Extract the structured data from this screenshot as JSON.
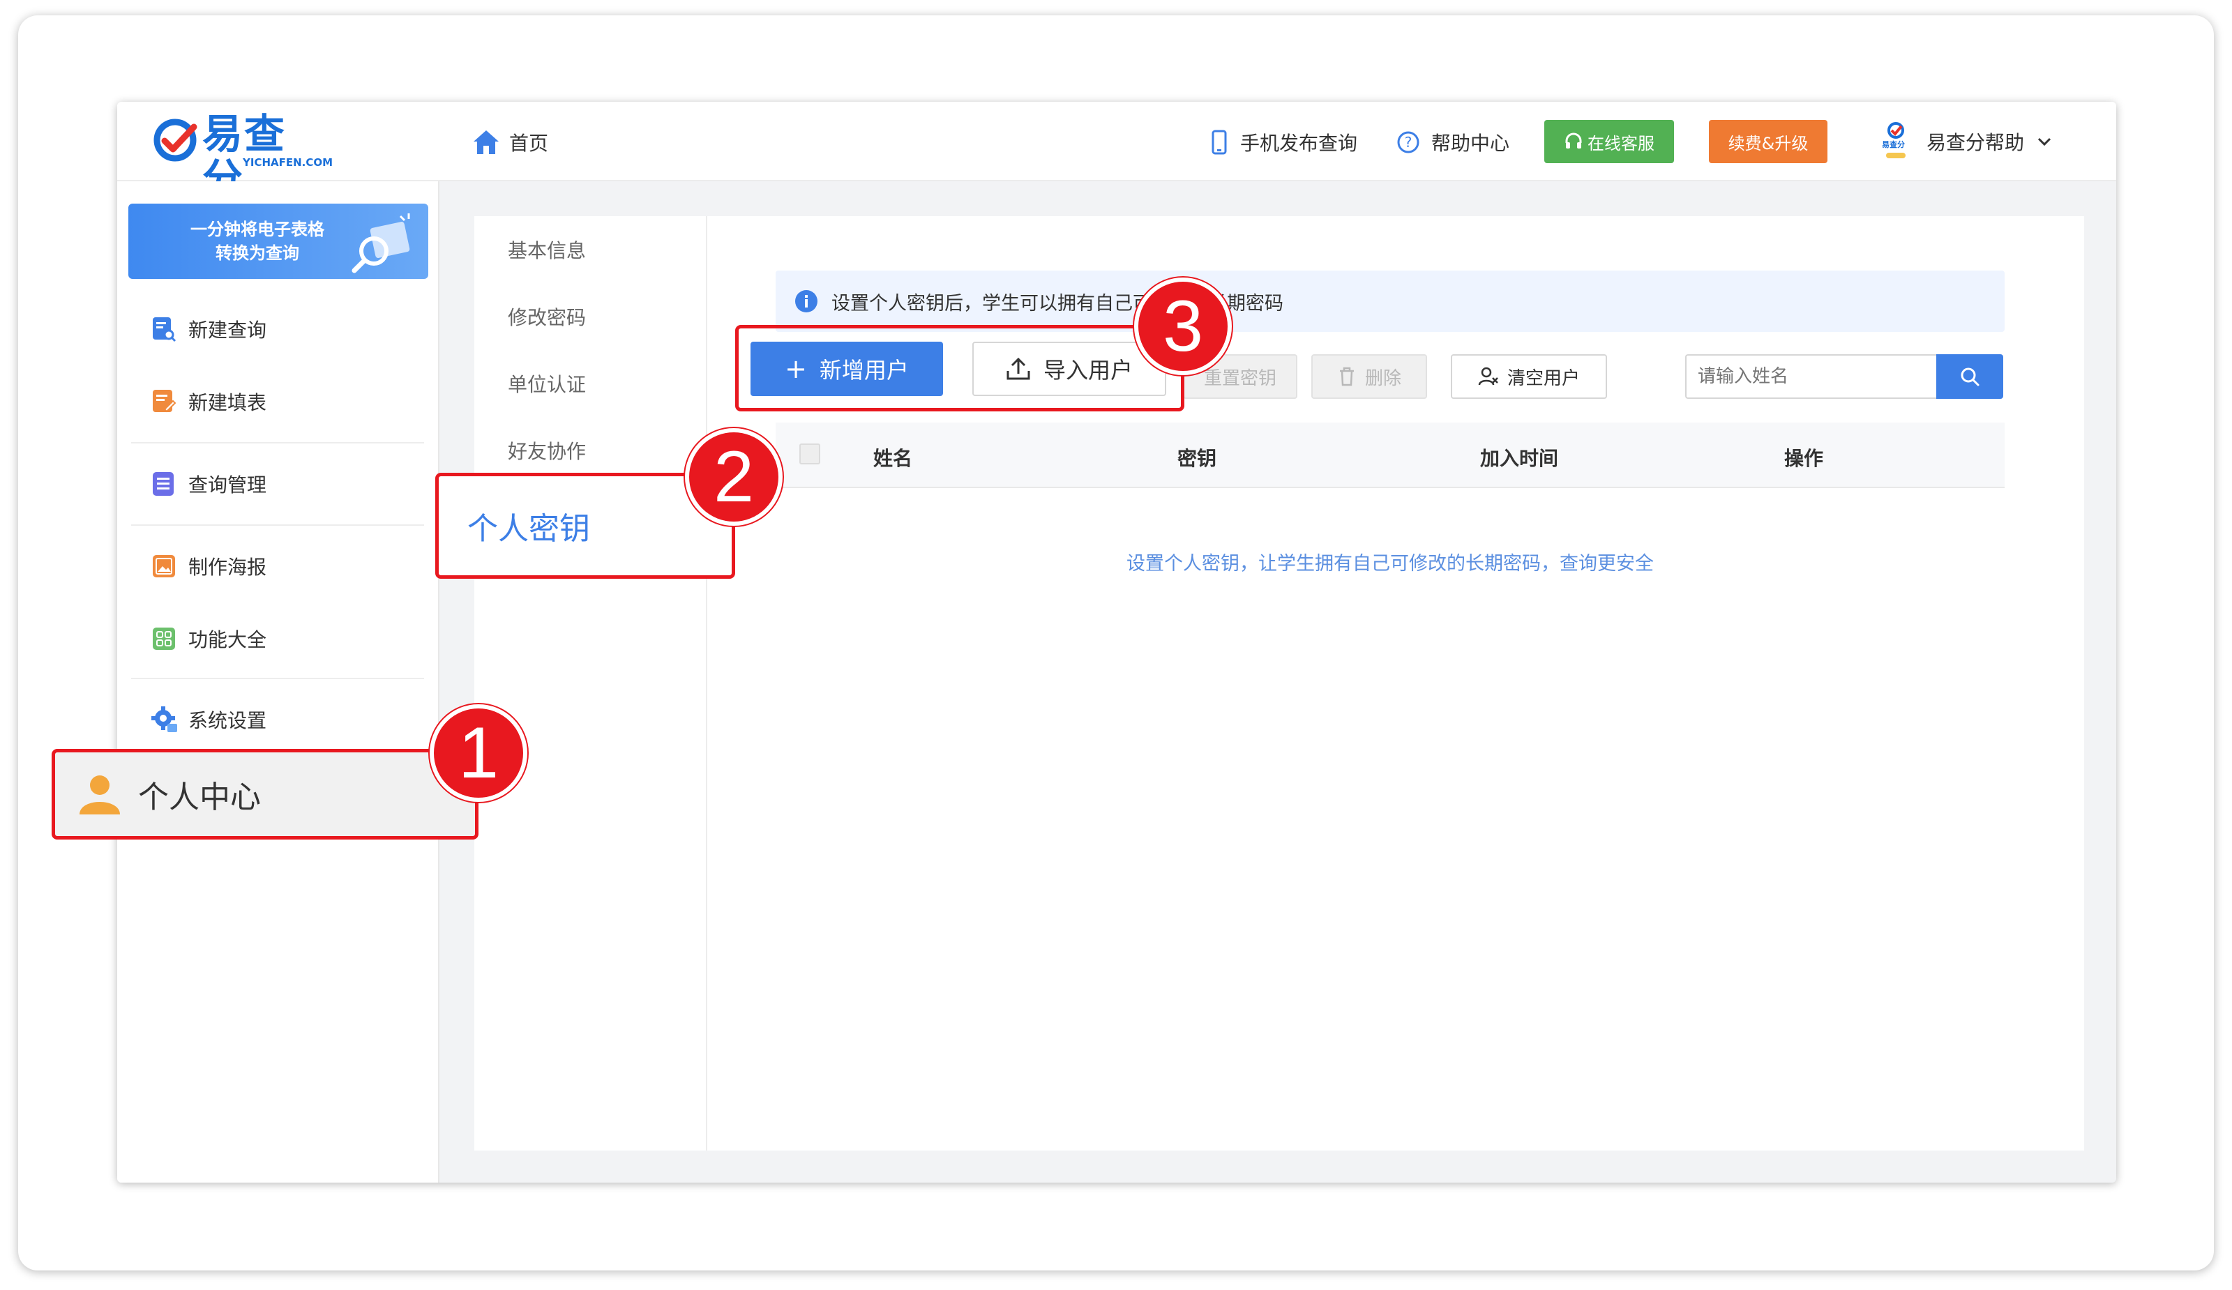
{
  "brand": {
    "logo_text": "易查分",
    "logo_sub": "YICHAFEN.COM",
    "logo_mark": "e-check-logo"
  },
  "header": {
    "home_label": "首页",
    "mobile_label": "手机发布查询",
    "help_label": "帮助中心",
    "service_label": "在线客服",
    "upgrade_label": "续费&升级",
    "user_label": "易查分帮助",
    "avatar_text": "易查分",
    "colors": {
      "service": "#52b153",
      "upgrade": "#ef7a32",
      "brand": "#1a6fd8"
    }
  },
  "sidebar": {
    "banner_line1": "一分钟将电子表格",
    "banner_line2": "转换为查询",
    "items": [
      {
        "label": "新建查询",
        "icon": "search-doc-icon",
        "color": "#3d7fe6"
      },
      {
        "label": "新建填表",
        "icon": "edit-form-icon",
        "color": "#f08a3c"
      },
      {
        "label": "查询管理",
        "icon": "list-icon",
        "color": "#6b6ee8"
      },
      {
        "label": "制作海报",
        "icon": "image-icon",
        "color": "#f08a3c"
      },
      {
        "label": "功能大全",
        "icon": "grid-icon",
        "color": "#6cc06c"
      },
      {
        "label": "系统设置",
        "icon": "gear-icon",
        "color": "#3d7fe6"
      },
      {
        "label": "个人中心",
        "icon": "user-icon",
        "color": "#f3a63b"
      }
    ]
  },
  "subnav": {
    "items": [
      "基本信息",
      "修改密码",
      "单位认证",
      "好友协作",
      "个人密钥"
    ],
    "active": "个人密钥"
  },
  "main": {
    "notice": "设置个人密钥后，学生可以拥有自己可修改的长期密码",
    "buttons": {
      "add_user": "新增用户",
      "import_user": "导入用户",
      "reset_key": "重置密钥",
      "delete": "删除",
      "clear_user": "清空用户"
    },
    "search_placeholder": "请输入姓名",
    "columns": [
      "姓名",
      "密钥",
      "加入时间",
      "操作"
    ],
    "empty_text": "设置个人密钥，让学生拥有自己可修改的长期密码，查询更安全"
  },
  "annotations": {
    "step1": "1",
    "step2": "2",
    "step3": "3",
    "color": "#e8181f"
  }
}
